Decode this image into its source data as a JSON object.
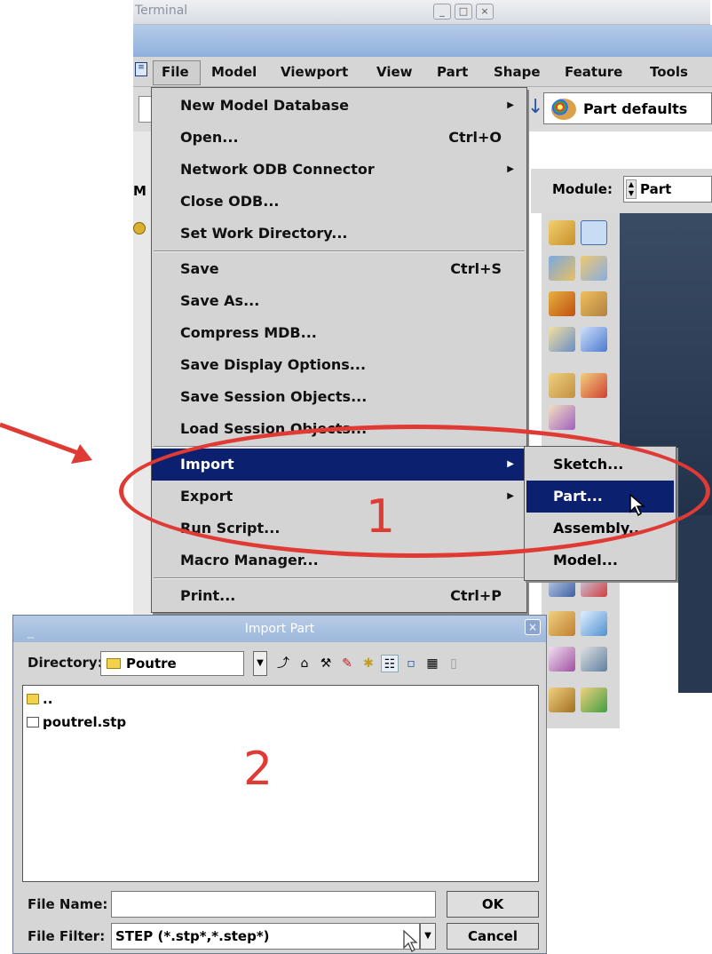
{
  "background_window": {
    "terminal_title": "Terminal",
    "module_label": "Module:",
    "module_value": "Part",
    "part_defaults": "Part defaults"
  },
  "menubar": [
    "File",
    "Model",
    "Viewport",
    "View",
    "Part",
    "Shape",
    "Feature",
    "Tools"
  ],
  "file_menu": {
    "items": [
      {
        "label": "New Model Database",
        "shortcut": "",
        "submenu": true
      },
      {
        "label": "Open...",
        "shortcut": "Ctrl+O",
        "submenu": false
      },
      {
        "label": "Network ODB Connector",
        "shortcut": "",
        "submenu": true
      },
      {
        "label": "Close ODB...",
        "shortcut": "",
        "submenu": false
      },
      {
        "label": "Set Work Directory...",
        "shortcut": "",
        "submenu": false
      },
      {
        "label": "Save",
        "shortcut": "Ctrl+S",
        "submenu": false
      },
      {
        "label": "Save As...",
        "shortcut": "",
        "submenu": false
      },
      {
        "label": "Compress MDB...",
        "shortcut": "",
        "submenu": false
      },
      {
        "label": "Save Display Options...",
        "shortcut": "",
        "submenu": false
      },
      {
        "label": "Save Session Objects...",
        "shortcut": "",
        "submenu": false
      },
      {
        "label": "Load Session Objects...",
        "shortcut": "",
        "submenu": false
      },
      {
        "label": "Import",
        "shortcut": "",
        "submenu": true,
        "highlighted": true
      },
      {
        "label": "Export",
        "shortcut": "",
        "submenu": true
      },
      {
        "label": "Run Script...",
        "shortcut": "",
        "submenu": false
      },
      {
        "label": "Macro Manager...",
        "shortcut": "",
        "submenu": false
      },
      {
        "label": "Print...",
        "shortcut": "Ctrl+P",
        "submenu": false
      }
    ]
  },
  "import_submenu": {
    "items": [
      {
        "label": "Sketch..."
      },
      {
        "label": "Part...",
        "highlighted": true
      },
      {
        "label": "Assembly..."
      },
      {
        "label": "Model..."
      }
    ]
  },
  "dialog": {
    "title": "Import Part",
    "directory_label": "Directory:",
    "directory_value": "Poutre",
    "files": [
      {
        "name": "..",
        "type": "folder"
      },
      {
        "name": "poutrel.stp",
        "type": "file"
      }
    ],
    "file_name_label": "File Name:",
    "file_name_value": "",
    "file_filter_label": "File Filter:",
    "file_filter_value": "STEP (*.stp*,*.step*)",
    "ok_label": "OK",
    "cancel_label": "Cancel"
  },
  "annotations": {
    "step1": "1",
    "step2": "2",
    "color": "#e03a34"
  },
  "colors": {
    "menu_highlight": "#0c2070",
    "menu_bg": "#d4d4d4",
    "titlebar": "#9db8dc",
    "viewport": "#2b3c56"
  }
}
